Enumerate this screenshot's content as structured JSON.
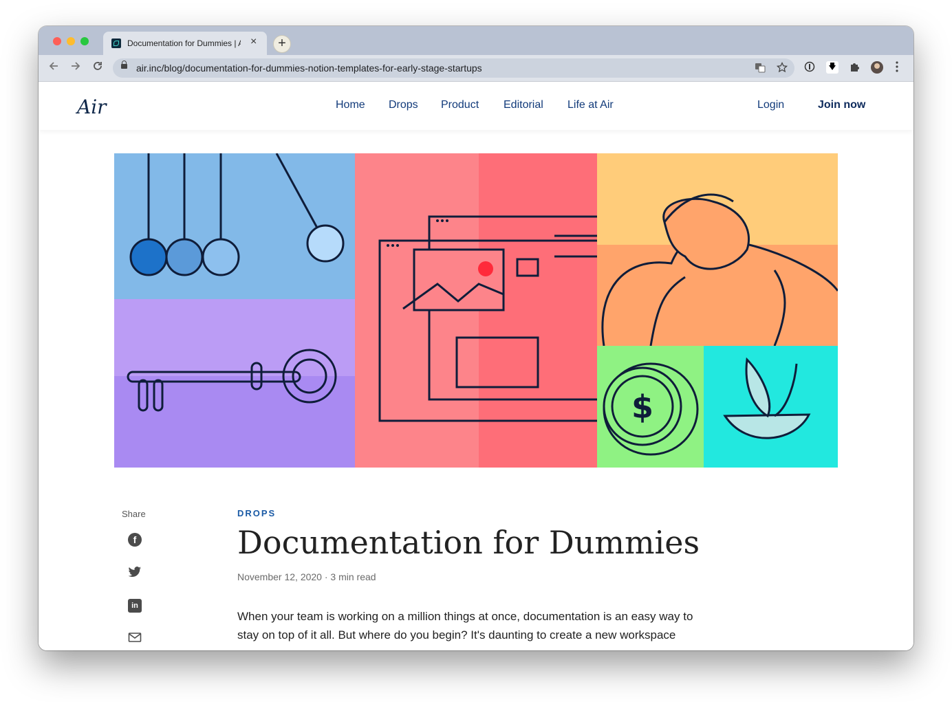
{
  "browser": {
    "tab_title": "Documentation for Dummies | Air",
    "tab_close": "×",
    "new_tab": "+",
    "url": "air.inc/blog/documentation-for-dummies-notion-templates-for-early-stage-startups",
    "icons": [
      "back-arrow-icon",
      "forward-arrow-icon",
      "reload-icon",
      "lock-icon",
      "translate-icon",
      "star-icon",
      "password-icon",
      "download-icon",
      "puzzle-icon",
      "avatar",
      "menu-icon"
    ]
  },
  "site": {
    "logo": "Air",
    "nav": [
      "Home",
      "Drops",
      "Product",
      "Editorial",
      "Life at Air"
    ],
    "login": "Login",
    "join": "Join now"
  },
  "article": {
    "share_label": "Share",
    "category": "DROPS",
    "title": "Documentation for Dummies",
    "date": "November 12, 2020",
    "read_time": "3 min read",
    "separator": "·",
    "intro": "When your team is working on a million things at once, documentation is an easy way to stay on top of it all. But where do you begin? It's daunting to create a new workspace"
  },
  "colors": {
    "nav_text": "#113a7a",
    "category": "#1a5aa5",
    "hero_blue": "#82b9e8",
    "hero_purple": "#bb9cf5",
    "hero_pink": "#fd848a",
    "hero_orange": "#ffa46b",
    "hero_green": "#8ff283",
    "hero_cyan": "#22e8df"
  }
}
